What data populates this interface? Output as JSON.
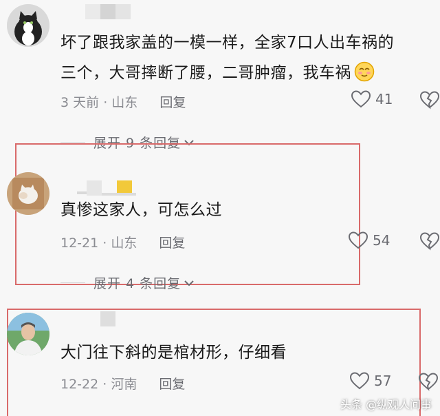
{
  "comments": [
    {
      "text_lines": [
        "坏了跟我家盖的一模一样，全家7口人出车祸的",
        "三个，大哥摔断了腰，二哥肿瘤，我车祸"
      ],
      "time": "3 天前",
      "location": "山东",
      "reply_label": "回复",
      "likes": "41",
      "expand_label": "展开 9 条回复"
    },
    {
      "text_lines": [
        "真惨这家人，可怎么过"
      ],
      "time": "12-21",
      "location": "山东",
      "reply_label": "回复",
      "likes": "54",
      "expand_label": "展开 4 条回复"
    },
    {
      "text_lines": [
        "大门往下斜的是棺材形，仔细看"
      ],
      "time": "12-22",
      "location": "河南",
      "reply_label": "回复",
      "likes": "57"
    }
  ],
  "meta_separator": "·",
  "watermark": "头条 @纵观人间事",
  "colors": {
    "highlight": "#d96a6a",
    "meta": "#8a8b91",
    "text": "#1a1a1a",
    "background": "#f7f7f7"
  }
}
